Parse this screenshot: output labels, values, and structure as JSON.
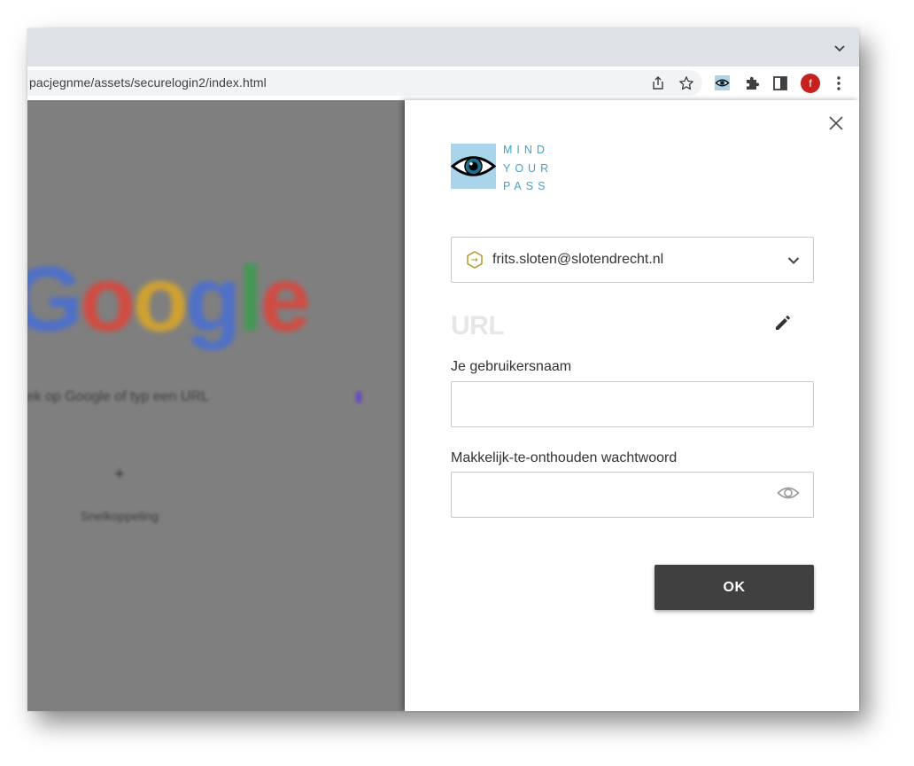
{
  "browser": {
    "url": "pacjegnme/assets/securelogin2/index.html",
    "profile_initial": "f",
    "icons": [
      "chevron-down-icon",
      "share-icon",
      "star-icon",
      "mindyourpass-extension-icon",
      "puzzle-icon",
      "side-panel-icon",
      "kebab-menu-icon"
    ]
  },
  "background_page": {
    "logo_letters": [
      "G",
      "o",
      "o",
      "g",
      "l",
      "e"
    ],
    "search_hint": "Zoek op Google of typ een URL",
    "shortcut_label": "Snelkoppeling toevoegen"
  },
  "panel": {
    "brand_line1": "MIND",
    "brand_line2": "YOUR",
    "brand_line3": "PASS",
    "account": "frits.sloten@slotendrecht.nl",
    "heading": "URL",
    "username_label": "Je gebruikersnaam",
    "username_value": "",
    "password_label": "Makkelijk-te-onthouden wachtwoord",
    "password_value": "",
    "ok_label": "OK"
  },
  "colors": {
    "brand_blue": "#3ba4cf",
    "logo_bg": "#a8d5ea",
    "button_dark": "#404040",
    "account_icon": "#b8962e"
  }
}
